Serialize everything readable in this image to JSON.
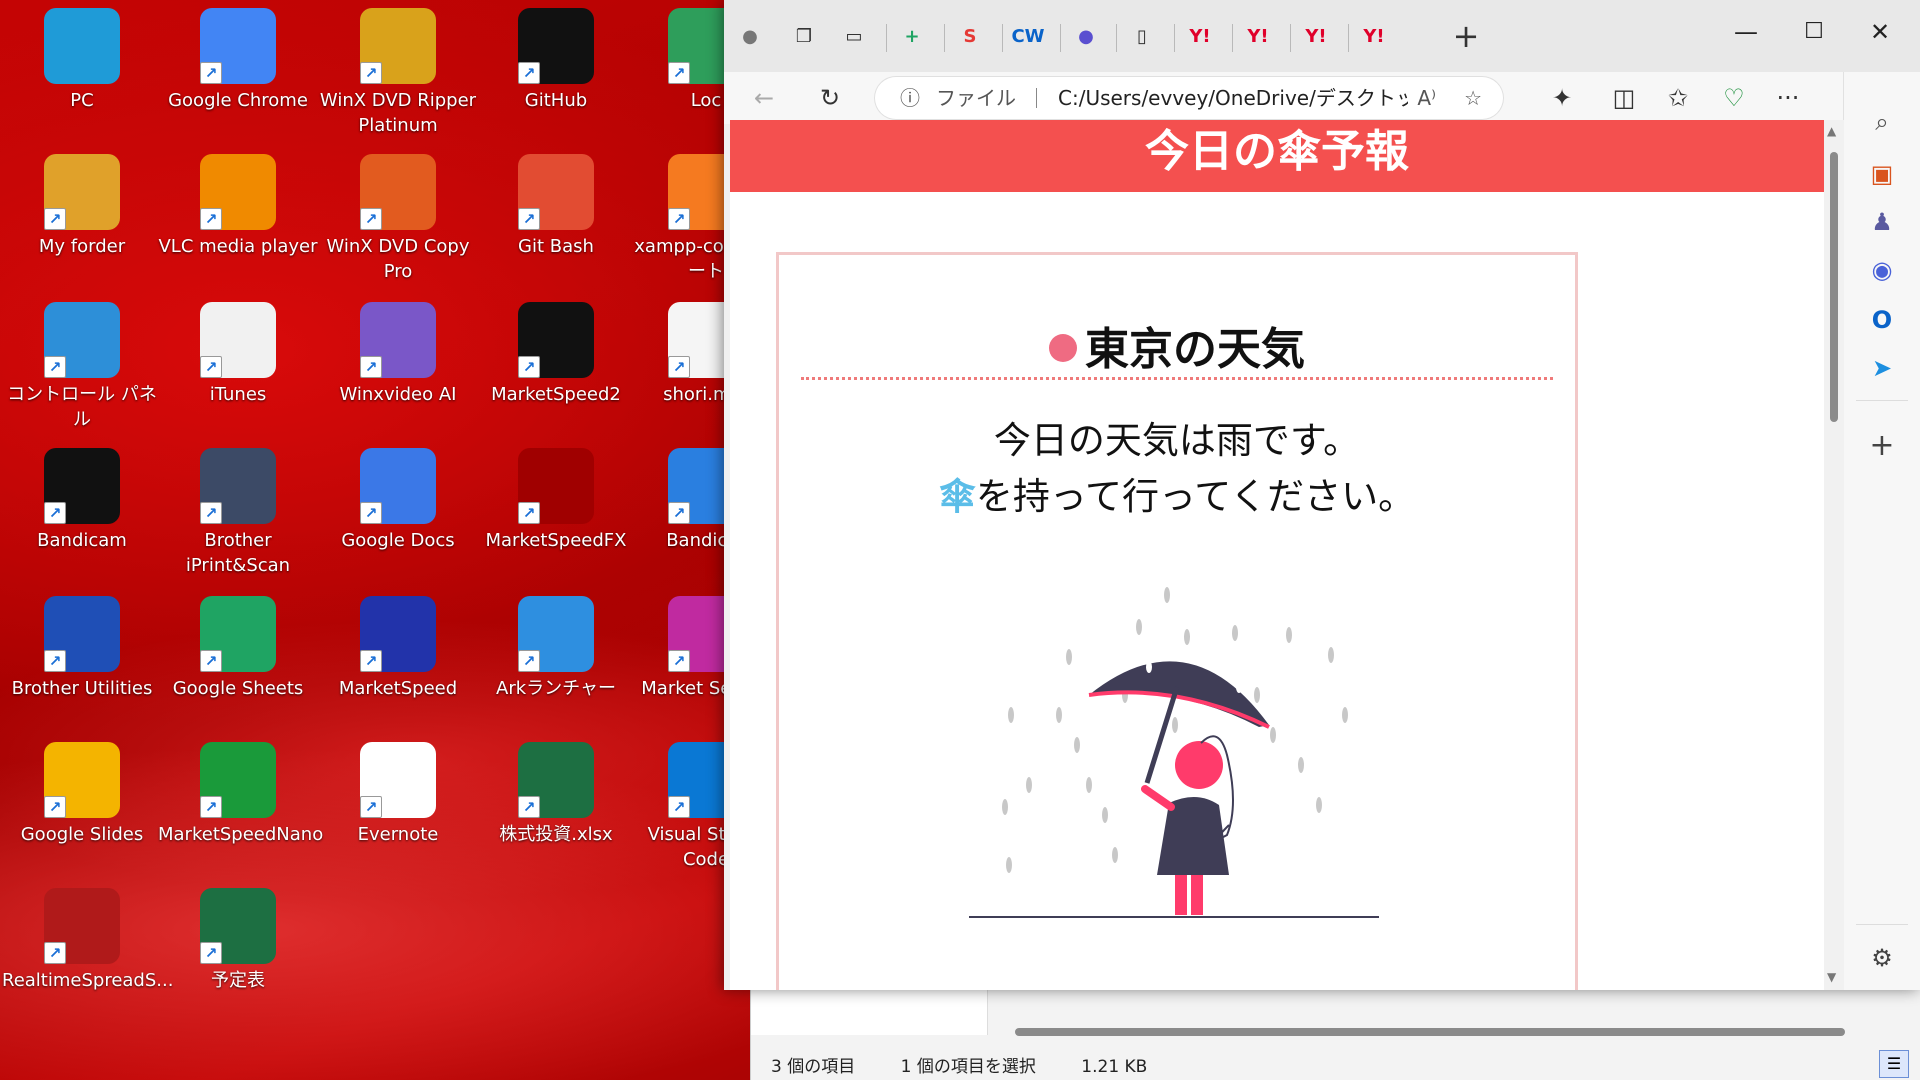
{
  "desktop": {
    "icons": [
      {
        "label": "PC",
        "icon": "monitor-icon",
        "color": "#1f9bd7"
      },
      {
        "label": "Google Chrome",
        "icon": "chrome-icon",
        "color": "#4285f4"
      },
      {
        "label": "WinX DVD Ripper Platinum",
        "icon": "dvd-ripper-icon",
        "color": "#d9a21b"
      },
      {
        "label": "GitHub",
        "icon": "github-icon",
        "color": "#111111"
      },
      {
        "label": "Loc",
        "icon": "local-icon",
        "color": "#2e9e5b"
      },
      {
        "label": "My forder",
        "icon": "folder-person-icon",
        "color": "#e0a12a"
      },
      {
        "label": "VLC media player",
        "icon": "vlc-icon",
        "color": "#f08a00"
      },
      {
        "label": "WinX DVD Copy Pro",
        "icon": "dvd-copy-icon",
        "color": "#e25b1f"
      },
      {
        "label": "Git Bash",
        "icon": "git-bash-icon",
        "color": "#e24c32"
      },
      {
        "label": "xampp-co - ショート",
        "icon": "xampp-icon",
        "color": "#f57a20"
      },
      {
        "label": "コントロール パネル",
        "icon": "control-panel-icon",
        "color": "#2d8fd8"
      },
      {
        "label": "iTunes",
        "icon": "itunes-icon",
        "color": "#f1f1f1"
      },
      {
        "label": "Winxvideo AI",
        "icon": "winxvideo-icon",
        "color": "#7a57c8"
      },
      {
        "label": "MarketSpeed2",
        "icon": "marketspeed2-icon",
        "color": "#111111"
      },
      {
        "label": "shori.mor",
        "icon": "text-file-icon",
        "color": "#f5f5f5"
      },
      {
        "label": "Bandicam",
        "icon": "bandicam-icon",
        "color": "#111111"
      },
      {
        "label": "Brother iPrint&Scan",
        "icon": "scanner-icon",
        "color": "#3c4a66"
      },
      {
        "label": "Google Docs",
        "icon": "google-docs-icon",
        "color": "#3b78e7"
      },
      {
        "label": "MarketSpeedFX",
        "icon": "marketspeedfx-icon",
        "color": "#a00000"
      },
      {
        "label": "Bandicut",
        "icon": "bandicut-icon",
        "color": "#2a7fe0"
      },
      {
        "label": "Brother Utilities",
        "icon": "brother-utilities-icon",
        "color": "#1f4fb6"
      },
      {
        "label": "Google Sheets",
        "icon": "google-sheets-icon",
        "color": "#1fa463"
      },
      {
        "label": "MarketSpeed",
        "icon": "marketspeed-icon",
        "color": "#2233aa"
      },
      {
        "label": "Arkランチャー",
        "icon": "ark-launcher-icon",
        "color": "#2e8fe0"
      },
      {
        "label": "Market Search",
        "icon": "market-search-icon",
        "color": "#c02aa0"
      },
      {
        "label": "Google Slides",
        "icon": "google-slides-icon",
        "color": "#f4b400"
      },
      {
        "label": "MarketSpeedNano",
        "icon": "marketspeednano-icon",
        "color": "#1a9a3a"
      },
      {
        "label": "Evernote",
        "icon": "evernote-icon",
        "color": "#ffffff"
      },
      {
        "label": "株式投資.xlsx",
        "icon": "excel-icon",
        "color": "#1d6f42"
      },
      {
        "label": "Visual Studio Code",
        "icon": "vscode-icon",
        "color": "#0a78d4"
      },
      {
        "label": "RealtimeSpreadS...",
        "icon": "realtime-spread-icon",
        "color": "#b01a1a"
      },
      {
        "label": "予定表",
        "icon": "excel-icon",
        "color": "#1d6f42"
      }
    ]
  },
  "browser": {
    "tabs": [
      {
        "icon": "profile-icon",
        "glyph": "●"
      },
      {
        "icon": "workspaces-icon",
        "glyph": "❐"
      },
      {
        "icon": "tab-actions-icon",
        "glyph": "▭"
      },
      {
        "icon": "sheets-tab-icon",
        "glyph": "+"
      },
      {
        "icon": "swirl-tab-icon",
        "glyph": "S"
      },
      {
        "icon": "cw-tab-icon",
        "glyph": "CW"
      },
      {
        "icon": "apple-tab-icon",
        "glyph": "●"
      },
      {
        "icon": "page-tab-icon",
        "glyph": "▯"
      },
      {
        "icon": "yahoo-tab-icon",
        "glyph": "Y!"
      },
      {
        "icon": "yahoo-tab-icon",
        "glyph": "Y!"
      },
      {
        "icon": "yahoo-tab-icon",
        "glyph": "Y!"
      },
      {
        "icon": "yahoo-tab-icon",
        "glyph": "Y!"
      }
    ],
    "new_tab": "+",
    "window": {
      "minimize": "—",
      "maximize": "☐",
      "close": "✕"
    },
    "address": {
      "info_icon": "ⓘ",
      "scheme_label": "ファイル",
      "url": "C:/Users/evvey/OneDrive/デスクトップ...",
      "read_aloud": "A⁾",
      "favorite": "☆"
    },
    "toolbar": {
      "back": "←",
      "refresh": "↻",
      "extensions": "✦",
      "split": "◫",
      "favorites": "✩",
      "health": "♡",
      "more": "···",
      "copilot": "◆"
    },
    "sidebar": {
      "search": "⌕",
      "tools": "▣",
      "games": "♟",
      "office": "◉",
      "outlook": "O",
      "send": "➤",
      "add": "+",
      "settings": "⚙"
    }
  },
  "page": {
    "header": "今日の傘予報",
    "card_title": "東京の天気",
    "message_line1": "今日の天気は雨です。",
    "message_kasa": "傘",
    "message_line2_rest": "を持って行ってください。"
  },
  "explorer": {
    "item_count": "3 個の項目",
    "selection": "1 個の項目を選択",
    "size": "1.21 KB",
    "view_icon": "☰"
  },
  "colors": {
    "header_bg": "#f4504f",
    "card_border": "#f2c8c8",
    "dot": "#ef6b82",
    "kasa_blue": "#5bbde8",
    "umbrella_dark": "#3f3d56",
    "accent_pink": "#ff3b6b"
  }
}
